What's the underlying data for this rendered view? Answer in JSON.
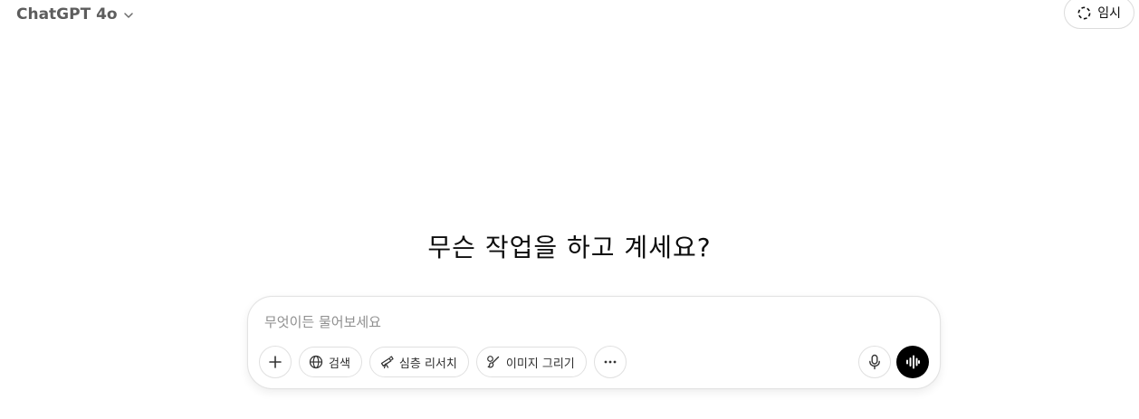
{
  "header": {
    "model_name": "ChatGPT 4o",
    "temporary_label": "임시"
  },
  "main": {
    "heading": "무슨 작업을 하고 계세요?"
  },
  "composer": {
    "placeholder": "무엇이든 물어보세요",
    "tools": {
      "search_label": "검색",
      "deep_research_label": "심층 리서치",
      "image_label": "이미지 그리기"
    }
  }
}
